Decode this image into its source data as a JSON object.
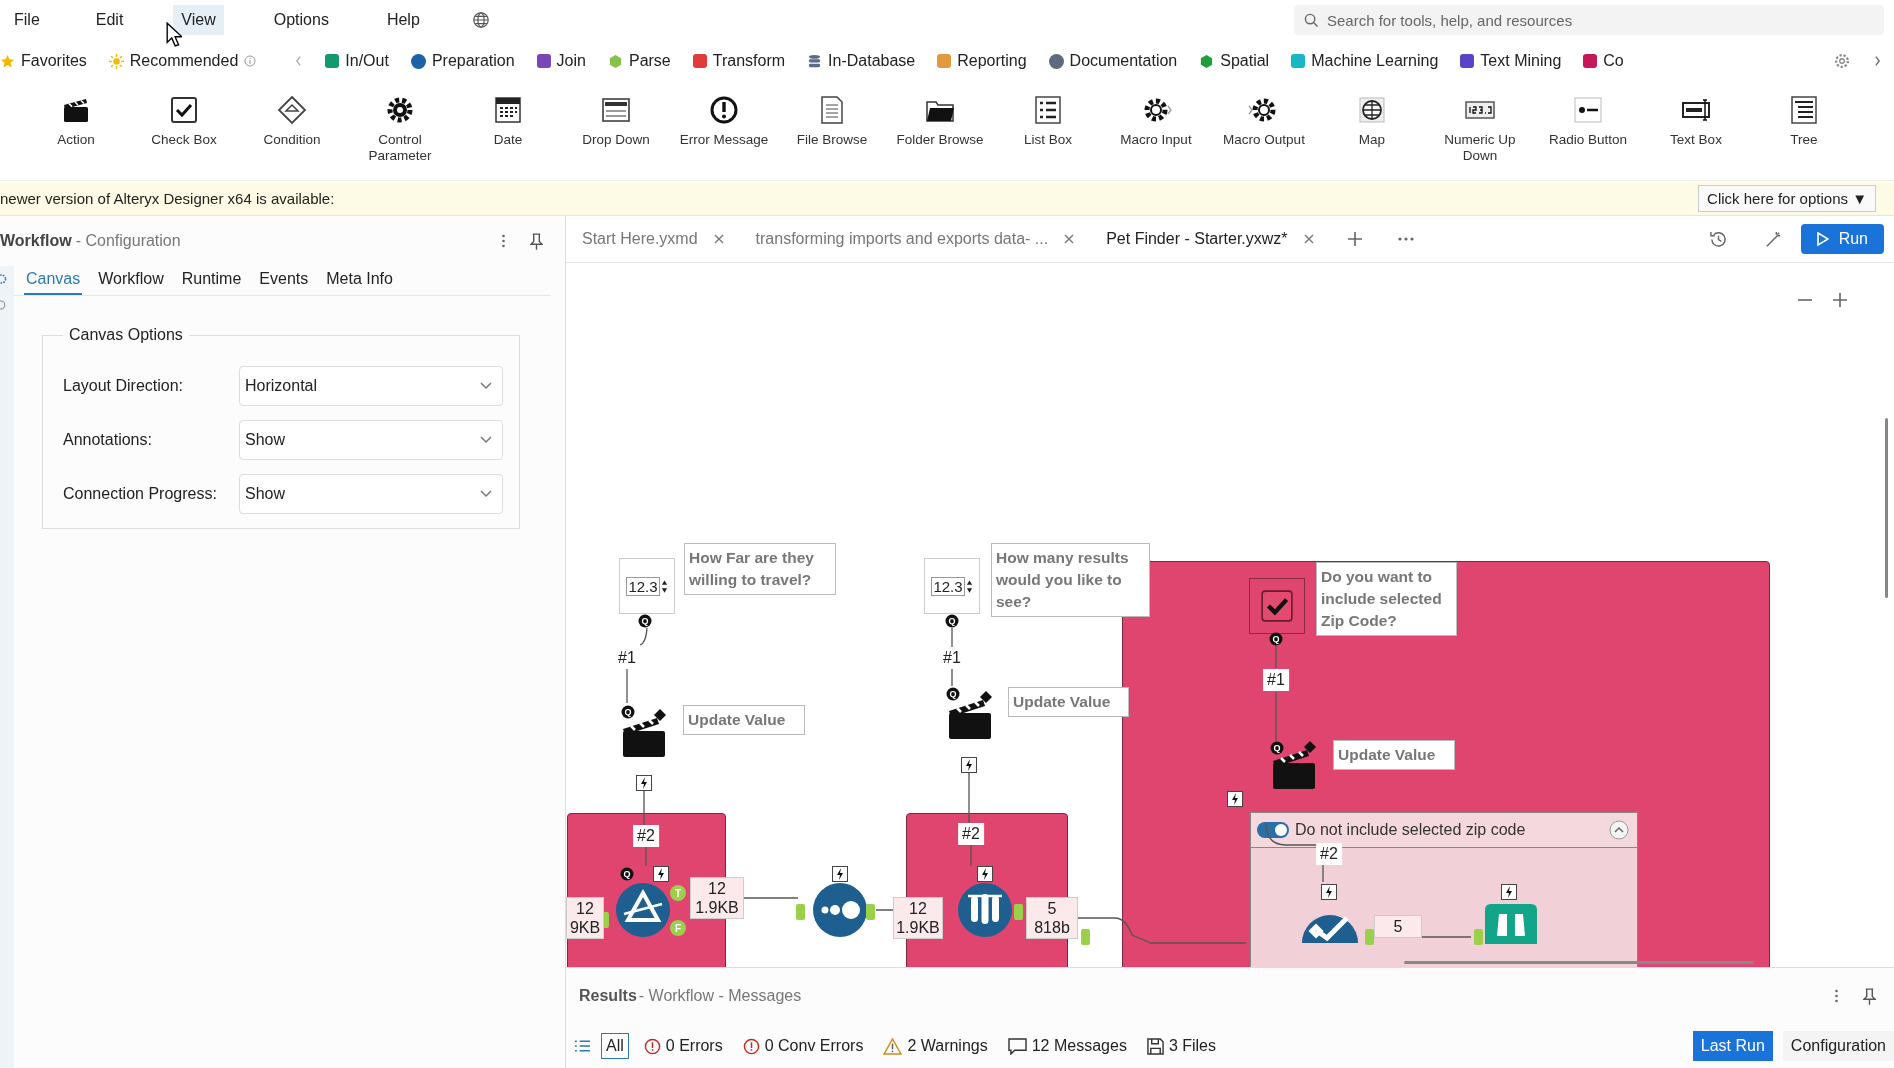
{
  "menu": [
    {
      "label": "File",
      "hovered": false
    },
    {
      "label": "Edit",
      "hovered": false
    },
    {
      "label": "View",
      "hovered": true
    },
    {
      "label": "Options",
      "hovered": false
    },
    {
      "label": "Help",
      "hovered": false
    }
  ],
  "search": {
    "placeholder": "Search for tools, help, and resources"
  },
  "categories": [
    {
      "label": "Favorites",
      "kind": "star",
      "color": "#f5b800"
    },
    {
      "label": "Recommended",
      "kind": "sun",
      "color": "#f5b800"
    },
    {
      "label": "In/Out",
      "kind": "tile",
      "color": "#139a6b"
    },
    {
      "label": "Preparation",
      "kind": "dot",
      "color": "#1a63a8"
    },
    {
      "label": "Join",
      "kind": "tile",
      "color": "#7b45b8"
    },
    {
      "label": "Parse",
      "kind": "hex",
      "color": "#86c14a"
    },
    {
      "label": "Transform",
      "kind": "tile",
      "color": "#e23b3b"
    },
    {
      "label": "In-Database",
      "kind": "db",
      "color": "#5a6b8c"
    },
    {
      "label": "Reporting",
      "kind": "tile",
      "color": "#e39a3c"
    },
    {
      "label": "Documentation",
      "kind": "dot",
      "color": "#5e6b7d"
    },
    {
      "label": "Spatial",
      "kind": "hex",
      "color": "#1f9e3c"
    },
    {
      "label": "Machine Learning",
      "kind": "tile",
      "color": "#19b6c6"
    },
    {
      "label": "Text Mining",
      "kind": "tile",
      "color": "#5a43c9"
    },
    {
      "label": "Co",
      "kind": "tile",
      "color": "#c4185a"
    }
  ],
  "tools": [
    {
      "label": "Action",
      "kind": "action"
    },
    {
      "label": "Check Box",
      "kind": "checkbox"
    },
    {
      "label": "Condition",
      "kind": "condition"
    },
    {
      "label": "Control Parameter",
      "kind": "control"
    },
    {
      "label": "Date",
      "kind": "date"
    },
    {
      "label": "Drop Down",
      "kind": "dropdown"
    },
    {
      "label": "Error Message",
      "kind": "error"
    },
    {
      "label": "File Browse",
      "kind": "file"
    },
    {
      "label": "Folder Browse",
      "kind": "folder"
    },
    {
      "label": "List Box",
      "kind": "listbox"
    },
    {
      "label": "Macro Input",
      "kind": "macroin"
    },
    {
      "label": "Macro Output",
      "kind": "macroout"
    },
    {
      "label": "Map",
      "kind": "map"
    },
    {
      "label": "Numeric Up Down",
      "kind": "numeric"
    },
    {
      "label": "Radio Button",
      "kind": "radio"
    },
    {
      "label": "Text Box",
      "kind": "textbox"
    },
    {
      "label": "Tree",
      "kind": "tree"
    }
  ],
  "notice": {
    "text": "newer version of Alteryx Designer x64 is available:",
    "button": "Click here for options ▼"
  },
  "config": {
    "title": "Workflow",
    "subtitle": "- Configuration",
    "tabs": [
      {
        "label": "Canvas",
        "selected": true
      },
      {
        "label": "Workflow",
        "selected": false
      },
      {
        "label": "Runtime",
        "selected": false
      },
      {
        "label": "Events",
        "selected": false
      },
      {
        "label": "Meta Info",
        "selected": false
      }
    ],
    "group": "Canvas Options",
    "fields": [
      {
        "label": "Layout Direction:",
        "value": "Horizontal"
      },
      {
        "label": "Annotations:",
        "value": "Show"
      },
      {
        "label": "Connection Progress:",
        "value": "Show"
      }
    ]
  },
  "doc_tabs": [
    {
      "label": "Start Here.yxmd",
      "selected": false
    },
    {
      "label": "transforming imports and exports data- ...",
      "selected": false
    },
    {
      "label": "Pet Finder - Starter.yxwz*",
      "selected": true
    }
  ],
  "run_button": "Run",
  "canvas": {
    "numeric_inputs": [
      {
        "value": "12.3"
      },
      {
        "value": "12.3"
      }
    ],
    "annotations": [
      "How Far are they willing to travel?",
      "Update Value",
      "How many results would you like to see?",
      "Update Value",
      "Do you want to include selected Zip Code?",
      "Update Value"
    ],
    "checkbox_tool": {
      "checked": true
    },
    "connection_labels": [
      "#1",
      "#2",
      "#1",
      "#2",
      "#1",
      "#2"
    ],
    "anchors": [
      "Q",
      "Q",
      "Q",
      "Q",
      "Q",
      "Q",
      "Q"
    ],
    "filter_outputs": [
      "T",
      "F"
    ],
    "record_counts": [
      {
        "count": "12",
        "size": "9KB"
      },
      {
        "count": "12",
        "size": "1.9KB"
      },
      {
        "count": "12",
        "size": "1.9KB"
      },
      {
        "count": "5",
        "size": "818b"
      },
      {
        "count": "5"
      }
    ],
    "container": {
      "title": "Do not include selected zip code",
      "enabled": true
    }
  },
  "results": {
    "title": "Results",
    "subtitle": "- Workflow - Messages",
    "filters": [
      {
        "label": "All",
        "kind": "all",
        "selected": true
      },
      {
        "label": "0 Errors",
        "kind": "error",
        "selected": false
      },
      {
        "label": "0 Conv Errors",
        "kind": "error",
        "selected": false
      },
      {
        "label": "2 Warnings",
        "kind": "warning",
        "selected": false
      },
      {
        "label": "12 Messages",
        "kind": "message",
        "selected": false
      },
      {
        "label": "3 Files",
        "kind": "file",
        "selected": false
      }
    ],
    "views": [
      {
        "label": "Last Run",
        "selected": true
      },
      {
        "label": "Configuration",
        "selected": false
      }
    ]
  }
}
